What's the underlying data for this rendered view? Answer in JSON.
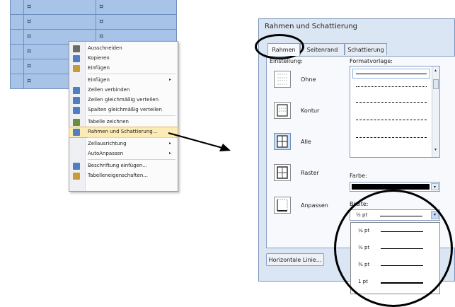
{
  "table": {
    "cell_mark": "¤",
    "rows": 6
  },
  "context_menu": {
    "items": [
      {
        "label": "Ausschneiden",
        "icon": "scissors-icon",
        "submenu": false
      },
      {
        "label": "Kopieren",
        "icon": "copy-icon",
        "submenu": false
      },
      {
        "label": "Einfügen",
        "icon": "paste-icon",
        "submenu": false
      },
      {
        "label": "Einfügen",
        "icon": "",
        "submenu": true
      },
      {
        "label": "Zellen verbinden",
        "icon": "merge-cells-icon",
        "submenu": false
      },
      {
        "label": "Zeilen gleichmäßig verteilen",
        "icon": "distribute-rows-icon",
        "submenu": false
      },
      {
        "label": "Spalten gleichmäßig verteilen",
        "icon": "distribute-columns-icon",
        "submenu": false
      },
      {
        "label": "Tabelle zeichnen",
        "icon": "pencil-icon",
        "submenu": false
      },
      {
        "label": "Rahmen und Schattierung...",
        "icon": "borders-icon",
        "submenu": false,
        "highlighted": true
      },
      {
        "label": "Zellausrichtung",
        "icon": "",
        "submenu": true
      },
      {
        "label": "AutoAnpassen",
        "icon": "",
        "submenu": true
      },
      {
        "label": "Beschriftung einfügen...",
        "icon": "caption-icon",
        "submenu": false
      },
      {
        "label": "Tabelleneigenschaften...",
        "icon": "table-properties-icon",
        "submenu": false
      }
    ],
    "submenu_arrow": "▸"
  },
  "dialog": {
    "title": "Rahmen und Schattierung",
    "tabs": [
      "Rahmen",
      "Seitenrand",
      "Schattierung"
    ],
    "active_tab": "Rahmen",
    "einstellung_label": "Einstellung:",
    "formatvorlage_label": "Formatvorlage:",
    "settings": [
      "Ohne",
      "Kontur",
      "Alle",
      "Raster",
      "Anpassen"
    ],
    "selected_setting": "Alle",
    "farbe_label": "Farbe:",
    "farbe_value": "#000000",
    "breite_label": "Breite:",
    "breite_value": "½ pt",
    "breite_options": [
      "¼ pt",
      "½ pt",
      "¾ pt",
      "1 pt"
    ],
    "horizontal_line_button": "Horizontale Linie...",
    "dropdown_arrow": "▾",
    "scroll_up": "▴",
    "scroll_down": "▾"
  },
  "colors": {
    "table_fill": "#a7c3e8",
    "menu_highlight": "#fdebb5",
    "dialog_bg": "#dbe6f4",
    "annotation": "#000000"
  }
}
